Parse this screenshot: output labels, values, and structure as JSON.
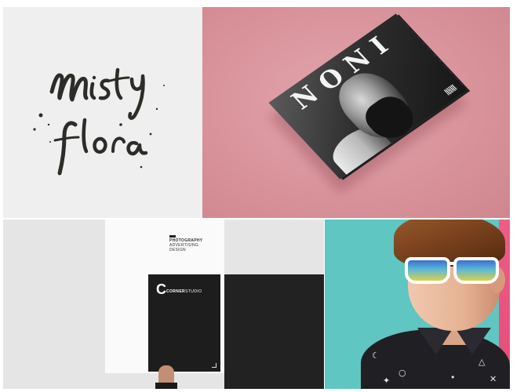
{
  "lettering": {
    "line1": "misty",
    "line2": "flora"
  },
  "magazine": {
    "masthead": "NONI"
  },
  "corner_studio": {
    "poster_lines": [
      "PHOTOGRAPHY",
      "ADVERTISING",
      "DESIGN"
    ],
    "logo_mark": "C",
    "brand_bold": "CORNER",
    "brand_light": "STUDIO"
  },
  "colors": {
    "tile1_bg": "#efefef",
    "tile2_bg": "#d9939b",
    "tile3_bg": "#e5e5e5",
    "tile4_bg": "#5fc6c2",
    "accent_pink": "#ee5d86"
  }
}
